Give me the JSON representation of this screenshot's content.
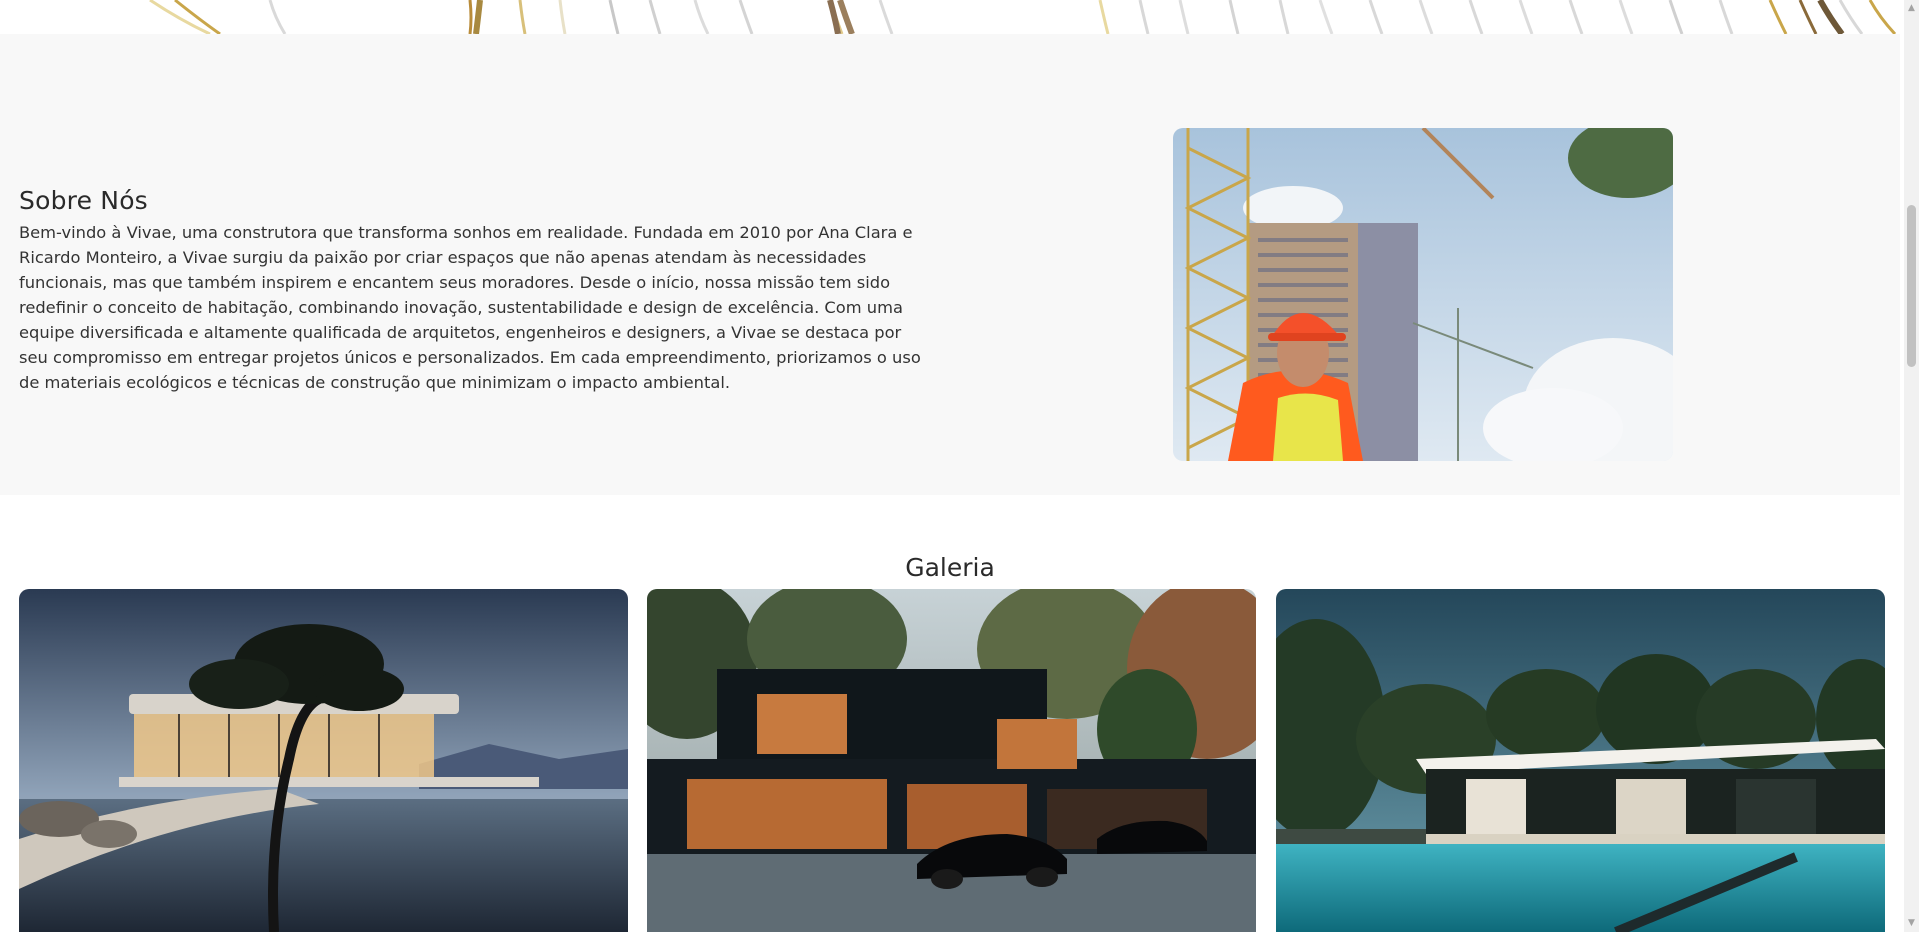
{
  "about": {
    "title": "Sobre Nós",
    "text": "Bem-vindo à Vivae, uma construtora que transforma sonhos em realidade. Fundada em 2010 por Ana Clara e Ricardo Monteiro, a Vivae surgiu da paixão por criar espaços que não apenas atendam às necessidades funcionais, mas que também inspirem e encantem seus moradores. Desde o início, nossa missão tem sido redefinir o conceito de habitação, combinando inovação, sustentabilidade e design de excelência. Com uma equipe diversificada e altamente qualificada de arquitetos, engenheiros e designers, a Vivae se destaca por seu compromisso em entregar projetos únicos e personalizados. Em cada empreendimento, priorizamos o uso de materiais ecológicos e técnicas de construção que minimizam o impacto ambiental.",
    "image_icon": "construction-worker-photo-icon"
  },
  "gallery": {
    "title": "Galeria",
    "images": [
      {
        "icon": "modern-house-tree-pool-photo-icon"
      },
      {
        "icon": "dark-house-sports-cars-photo-icon"
      },
      {
        "icon": "white-house-pool-photo-icon"
      }
    ]
  },
  "colors": {
    "section_bg": "#f8f8f8",
    "page_bg": "#ffffff",
    "gold": "#c9a64a",
    "text": "#333333"
  }
}
